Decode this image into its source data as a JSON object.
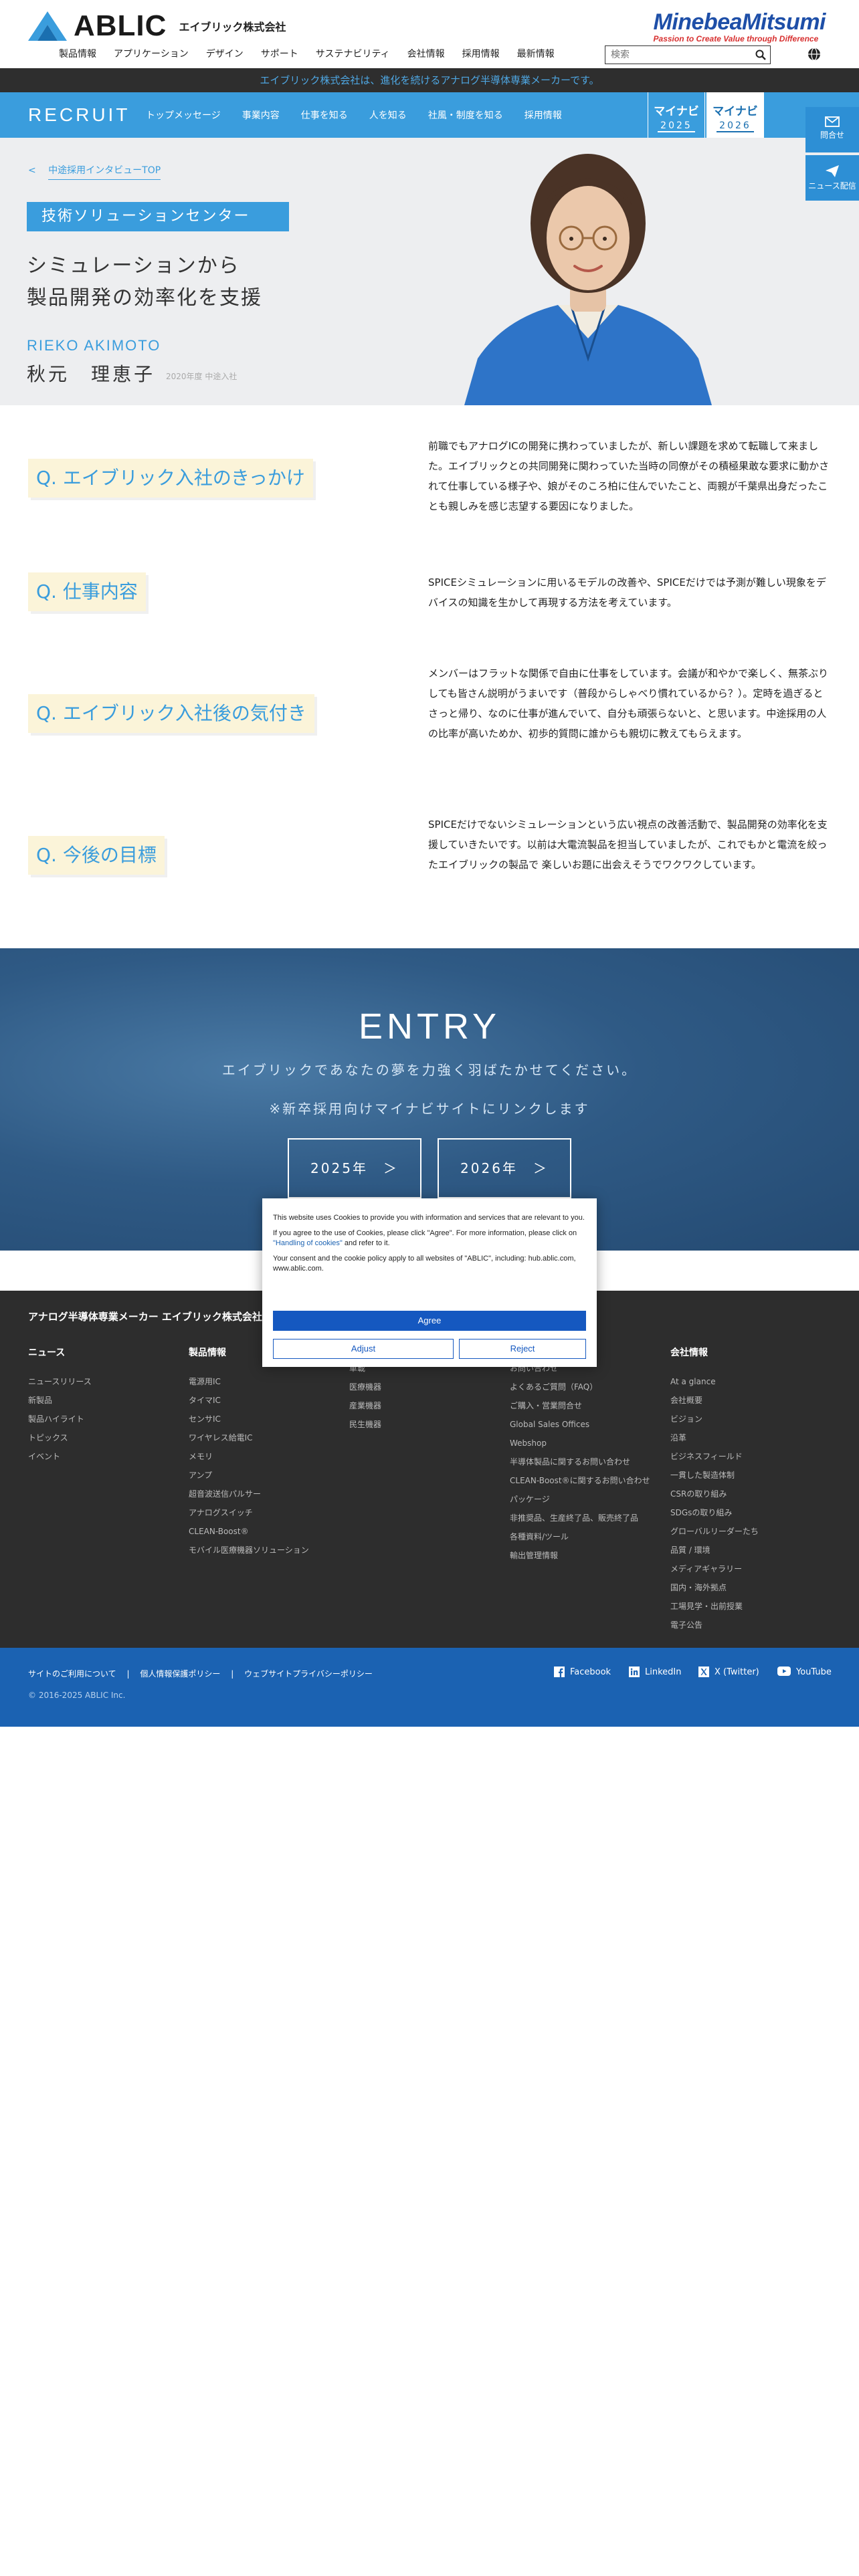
{
  "header": {
    "logo_text": "ABLIC",
    "logo_jp": "エイブリック株式会社",
    "group_logo": "MinebeaMitsumi",
    "group_tagline": "Passion to Create Value through Difference",
    "nav": [
      "製品情報",
      "アプリケーション",
      "デザイン",
      "サポート",
      "サステナビリティ",
      "会社情報",
      "採用情報",
      "最新情報"
    ],
    "search_placeholder": "検索",
    "notice": "エイブリック株式会社は、進化を続けるアナログ半導体専業メーカーです。"
  },
  "recruit": {
    "title": "RECRUIT",
    "nav": [
      "トップメッセージ",
      "事業内容",
      "仕事を知る",
      "人を知る",
      "社風・制度を知る",
      "採用情報"
    ],
    "mynavi": [
      {
        "title": "マイナビ",
        "year": "2025"
      },
      {
        "title": "マイナビ",
        "year": "2026"
      }
    ]
  },
  "side": {
    "contact": "問合せ",
    "news": "ニュース配信"
  },
  "hero": {
    "back_label": "中途採用インタビューTOP",
    "department": "技術ソリューションセンター",
    "headline_1": "シミュレーションから",
    "headline_2": "製品開発の効率化を支援",
    "name_roman": "RIEKO AKIMOTO",
    "name_kanji": "秋元　理恵子",
    "join_year": "2020年度 中途入社"
  },
  "qa": [
    {
      "q": "Q. エイブリック入社のきっかけ",
      "a": "前職でもアナログICの開発に携わっていましたが、新しい課題を求めて転職して来ました。エイブリックとの共同開発に関わっていた当時の同僚がその積極果敢な要求に動かされて仕事している様子や、娘がそのころ柏に住んでいたこと、両親が千葉県出身だったことも親しみを感じ志望する要因になりました。"
    },
    {
      "q": "Q. 仕事内容",
      "a": "SPICEシミュレーションに用いるモデルの改善や、SPICEだけでは予測が難しい現象をデバイスの知識を生かして再現する方法を考えています。"
    },
    {
      "q": "Q. エイブリック入社後の気付き",
      "a": "メンバーはフラットな関係で自由に仕事をしています。会議が和やかで楽しく、無茶ぶりしても皆さん説明がうまいです（普段からしゃべり慣れているから？）。定時を過ぎるとさっと帰り、なのに仕事が進んでいて、自分も頑張らないと、と思います。中途採用の人の比率が高いためか、初歩的質問に誰からも親切に教えてもらえます。"
    },
    {
      "q": "Q. 今後の目標",
      "a": "SPICEだけでないシミュレーションという広い視点の改善活動で、製品開発の効率化を支援していきたいです。以前は大電流製品を担当していましたが、これでもかと電流を絞ったエイブリックの製品で 楽しいお題に出会えそうでワクワクしています。"
    }
  ],
  "entry": {
    "title": "ENTRY",
    "subtitle": "エイブリックであなたの夢を力強く羽ばたかせてください。",
    "note": "※新卒採用向けマイナビサイトにリンクします",
    "buttons": [
      "2025年　＞",
      "2026年　＞"
    ]
  },
  "footer": {
    "heading": "アナログ半導体専業メーカー エイブリック株式会社",
    "columns": [
      {
        "title": "ニュース",
        "items": [
          "ニュースリリース",
          "新製品",
          "製品ハイライト",
          "トピックス",
          "イベント"
        ]
      },
      {
        "title": "製品情報",
        "items": [
          "電源用IC",
          "タイマIC",
          "センサIC",
          "ワイヤレス給電IC",
          "メモリ",
          "アンプ",
          "超音波送信パルサー",
          "アナログスイッチ",
          "CLEAN-Boost®",
          "モバイル医療機器ソリューション"
        ]
      },
      {
        "title": "",
        "items": [
          "車載",
          "医療機器",
          "産業機器",
          "民生機器"
        ]
      },
      {
        "title": "",
        "items": [
          "お問い合わせ",
          "よくあるご質問（FAQ）",
          "ご購入・営業問合せ",
          "Global Sales Offices",
          "Webshop",
          "半導体製品に関するお問い合わせ",
          "CLEAN-Boost®に関するお問い合わせ",
          "パッケージ",
          "非推奨品、生産終了品、販売終了品",
          "各種資料/ツール",
          "輸出管理情報"
        ]
      },
      {
        "title": "会社情報",
        "items": [
          "At a glance",
          "会社概要",
          "ビジョン",
          "沿革",
          "ビジネスフィールド",
          "一貫した製造体制",
          "CSRの取り組み",
          "SDGsの取り組み",
          "グローバルリーダーたち",
          "品質 / 環境",
          "メディアギャラリー",
          "国内・海外拠点",
          "工場見学・出前授業",
          "電子公告"
        ]
      }
    ],
    "legal": [
      "サイトのご利用について",
      "|",
      "個人情報保護ポリシー",
      "|",
      "ウェブサイトプライバシーポリシー"
    ],
    "copyright": "© 2016-2025 ABLIC Inc.",
    "social": [
      "Facebook",
      "LinkedIn",
      "X (Twitter)",
      "YouTube"
    ]
  },
  "cookie": {
    "p1": "This website uses Cookies to provide you with information and services that are relevant to you.",
    "p2_a": "If you agree to the use of Cookies, please click \"Agree\". For more information, please click on ",
    "p2_link": "\"Handling of cookies\"",
    "p2_b": " and refer to it.",
    "p3": "Your consent and the cookie policy apply to all websites of \"ABLIC\", including: hub.ablic.com, www.ablic.com.",
    "agree": "Agree",
    "adjust": "Adjust",
    "reject": "Reject"
  },
  "colors": {
    "brand_blue": "#3a9ddd",
    "question_bg": "#fbf4d9",
    "dark_footer": "#2d2d2d",
    "sub_footer": "#1b62b2"
  }
}
